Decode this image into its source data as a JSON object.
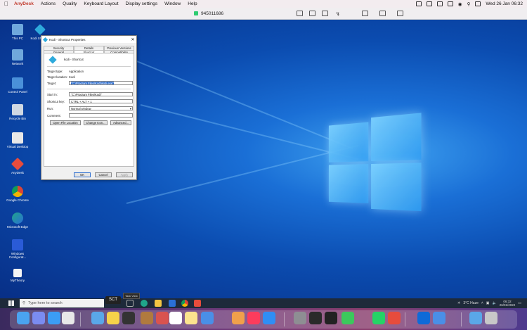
{
  "mac_menubar": {
    "app_name": "AnyDesk",
    "items": [
      "Actions",
      "Quality",
      "Keyboard Layout",
      "Display settings",
      "Window",
      "Help"
    ],
    "datetime": "Wed 26 Jan  06:32"
  },
  "anydesk": {
    "session_id": "945011686"
  },
  "desktop_icons": [
    {
      "label": "This PC",
      "icon": "computer-icon",
      "color": "#6fa8dc"
    },
    {
      "label": "Network",
      "icon": "network-icon",
      "color": "#6fa8dc"
    },
    {
      "label": "Control Panel",
      "icon": "control-panel-icon",
      "color": "#4a90d9"
    },
    {
      "label": "Recycle Bin",
      "icon": "recycle-bin-icon",
      "color": "#cfd8e3"
    },
    {
      "label": "Virtual Desktop",
      "icon": "virtual-desktop-icon",
      "color": "#e8e8e8"
    },
    {
      "label": "AnyDesk",
      "icon": "anydesk-icon",
      "color": "#e74c3c"
    },
    {
      "label": "Google Chrome",
      "icon": "chrome-icon",
      "color": "#f4b400"
    },
    {
      "label": "Microsoft Edge",
      "icon": "edge-icon",
      "color": "#1fa58a"
    },
    {
      "label": "Windows Configurat...",
      "icon": "windows-config-icon",
      "color": "#2a5bd7"
    },
    {
      "label": "MyTheory",
      "icon": "mytheory-icon",
      "color": "#f5f5f5"
    }
  ],
  "kodi_icon_label": "Kodi Shortc...",
  "dialog": {
    "title": "Kodi - Shortcut Properties",
    "tabs_top": [
      "Security",
      "Details",
      "Previous Versions"
    ],
    "tabs_bottom": [
      "General",
      "Shortcut",
      "Compatibility"
    ],
    "name": "kodi - Shortcut",
    "target_type_label": "Target type:",
    "target_type_value": "Application",
    "target_location_label": "Target location:",
    "target_location_value": "Kodi",
    "target_label": "Target:",
    "target_value": "\"C:\\Program Files\\Kodi\\kodi.exe\"",
    "start_in_label": "Start in:",
    "start_in_value": "\"C:\\Program Files\\Kodi\"",
    "shortcut_key_label": "Shortcut key:",
    "shortcut_key_value": "CTRL + ALT + 1",
    "run_label": "Run:",
    "run_value": "Normal window",
    "comment_label": "Comment:",
    "comment_value": "",
    "btn_open_location": "Open File Location",
    "btn_change_icon": "Change Icon...",
    "btn_advanced": "Advanced...",
    "btn_ok": "OK",
    "btn_cancel": "Cancel",
    "btn_apply": "Apply"
  },
  "taskbar": {
    "search_placeholder": "Type here to search",
    "sct_badge": "SCT",
    "taskview_tooltip": "Task View",
    "weather": "3°C  Haze",
    "time": "06:32",
    "date": "26/01/2022"
  },
  "dock_apps": [
    {
      "name": "finder-icon",
      "color": "#4aa3f0"
    },
    {
      "name": "launchpad-icon",
      "color": "#7a8cf0"
    },
    {
      "name": "safari-icon",
      "color": "#3b9df5"
    },
    {
      "name": "chrome-icon",
      "color": "#e8e8e8"
    },
    {
      "name": "folder-icon",
      "color": "#5aa7e8"
    },
    {
      "name": "notes-icon",
      "color": "#f7d24a"
    },
    {
      "name": "screenshot-icon",
      "color": "#333333"
    },
    {
      "name": "books-icon",
      "color": "#b07a3e"
    },
    {
      "name": "photo-booth-icon",
      "color": "#d9534f"
    },
    {
      "name": "calendar-icon",
      "color": "#ffffff"
    },
    {
      "name": "notes2-icon",
      "color": "#fbe38e"
    },
    {
      "name": "mail-icon",
      "color": "#4a8fe7"
    },
    {
      "name": "photos-icon",
      "color": "#f0a04b"
    },
    {
      "name": "music-icon",
      "color": "#fc3c5c"
    },
    {
      "name": "appstore-icon",
      "color": "#2f8ef5"
    },
    {
      "name": "system-preferences-icon",
      "color": "#8e8e93"
    },
    {
      "name": "x11-icon",
      "color": "#2a2a2a"
    },
    {
      "name": "xcode-icon",
      "color": "#222222"
    },
    {
      "name": "messages-icon",
      "color": "#3cc85c"
    },
    {
      "name": "whatsapp-icon",
      "color": "#25d366"
    },
    {
      "name": "anydesk-dock-icon",
      "color": "#e74c3c"
    },
    {
      "name": "teamviewer-icon",
      "color": "#0e6ad8"
    },
    {
      "name": "phone-icon",
      "color": "#4a8fe7"
    },
    {
      "name": "screenshot-app-icon",
      "color": "#5aa7e8"
    },
    {
      "name": "trash-icon",
      "color": "#c8c8c8"
    }
  ]
}
